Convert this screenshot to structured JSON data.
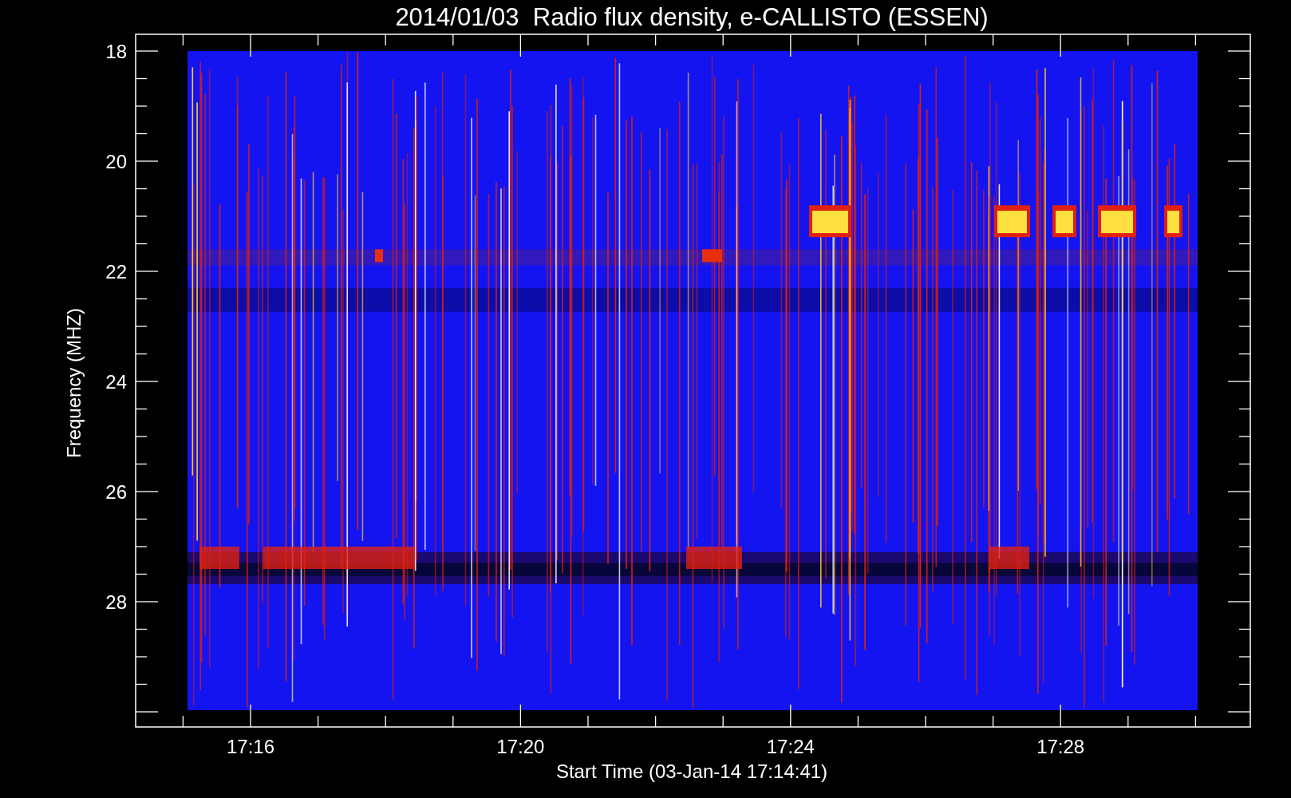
{
  "title": "2014/01/03  Radio flux density, e-CALLISTO (ESSEN)",
  "y_axis": {
    "label": "Frequency (MHZ)",
    "ticks": [
      "18",
      "20",
      "22",
      "24",
      "26",
      "28"
    ]
  },
  "x_axis": {
    "label": "Start Time (03-Jan-14 17:14:41)",
    "ticks": [
      "17:16",
      "17:20",
      "17:24",
      "17:28"
    ]
  }
}
